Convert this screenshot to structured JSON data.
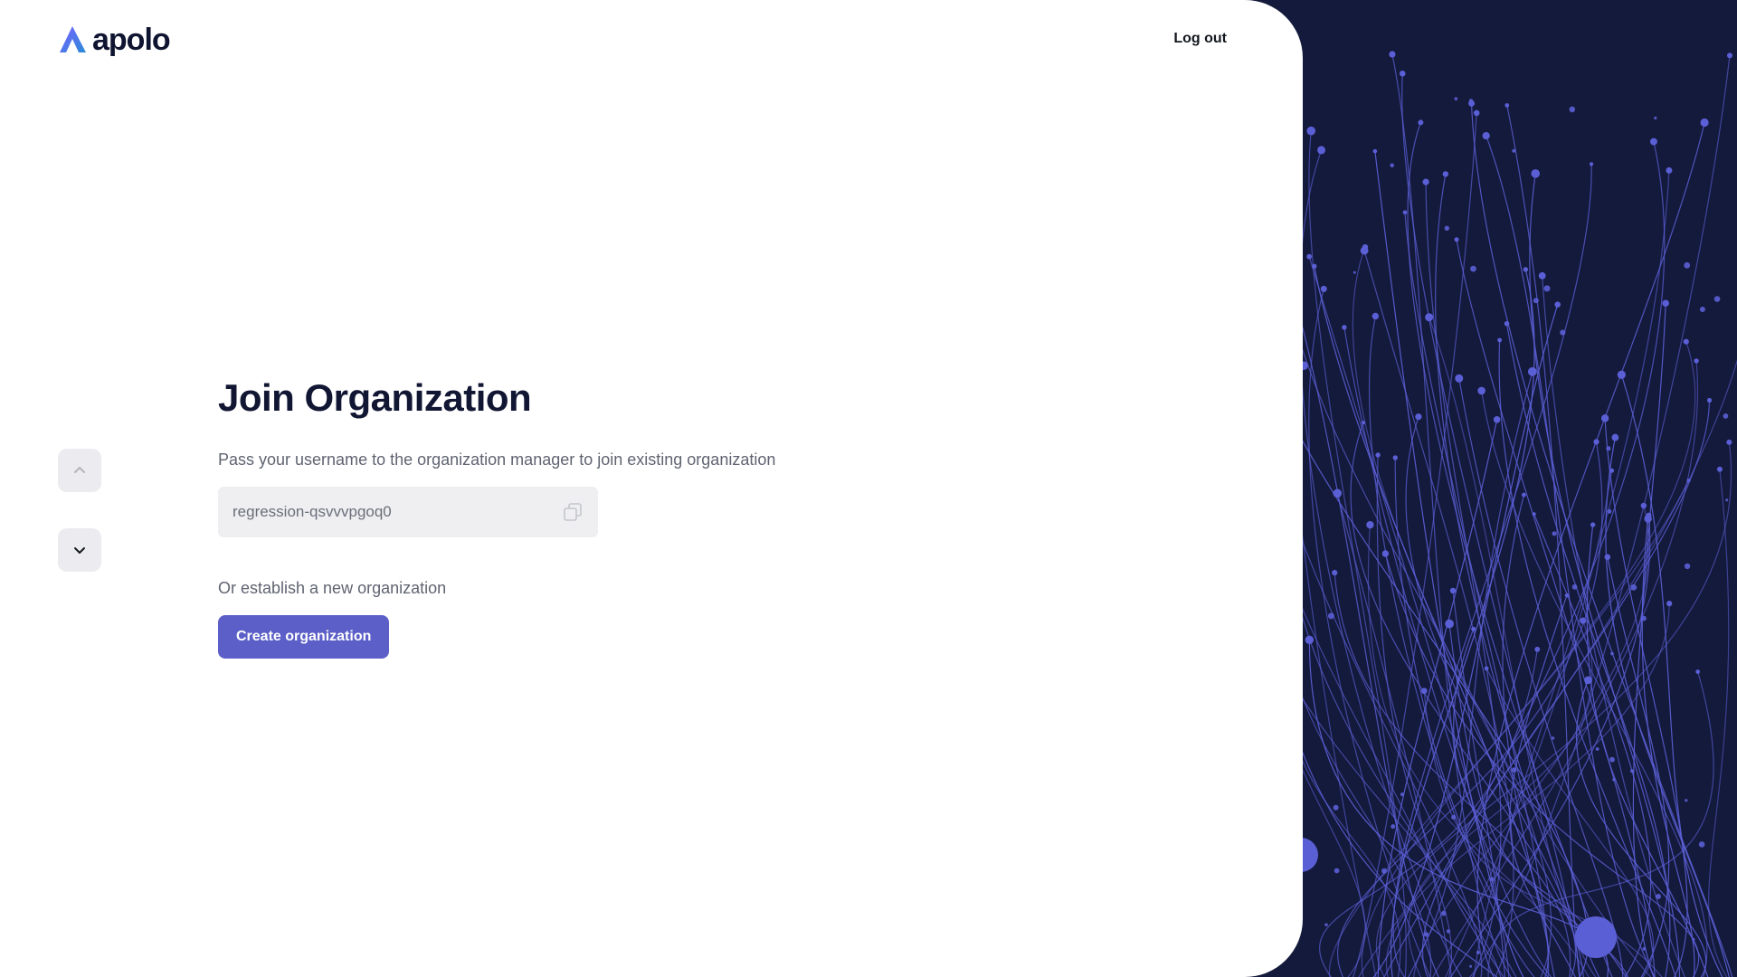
{
  "header": {
    "logo_text": "apolo",
    "logout_label": "Log out"
  },
  "nav": {
    "up_icon": "chevron-up-icon",
    "down_icon": "chevron-down-icon"
  },
  "main": {
    "title": "Join Organization",
    "description": "Pass your username to the organization manager to join existing organization",
    "username": "regression-qsvvvpgoq0",
    "copy_icon": "copy-icon",
    "alternative_text": "Or establish a new organization",
    "create_button_label": "Create organization"
  },
  "colors": {
    "brand_primary": "#5b5fc7",
    "art_background": "#141a3b",
    "art_accent": "#5b5fd6",
    "title_text": "#111633"
  }
}
